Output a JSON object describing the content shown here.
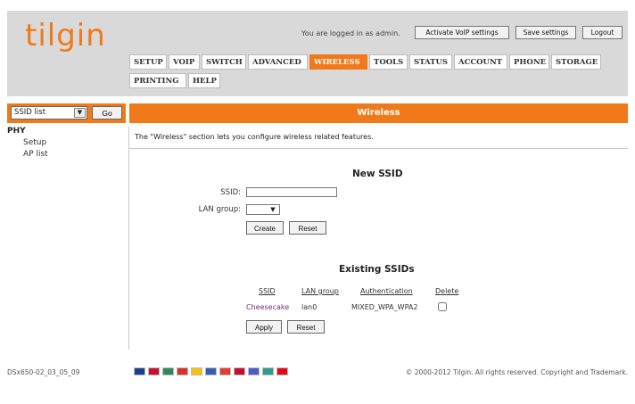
{
  "header": {
    "logo_text": "tilgin",
    "login_text": "You are logged in as admin.",
    "buttons": {
      "activate_voip": "Activate VoIP settings",
      "save_settings": "Save settings",
      "logout": "Logout"
    }
  },
  "nav": {
    "tabs": [
      "SETUP",
      "VOIP",
      "SWITCH",
      "ADVANCED",
      "WIRELESS",
      "TOOLS",
      "STATUS",
      "ACCOUNT",
      "PHONE",
      "STORAGE",
      "PRINTING",
      "HELP"
    ],
    "active_tab": "WIRELESS"
  },
  "left_panel": {
    "select_value": "SSID list",
    "go_label": "Go",
    "group_title": "PHY",
    "links": [
      "Setup",
      "AP list"
    ]
  },
  "main": {
    "title": "Wireless",
    "description": "The \"Wireless\" section lets you configure wireless related features.",
    "new_ssid": {
      "heading": "New SSID",
      "ssid_label": "SSID:",
      "ssid_value": "",
      "lan_group_label": "LAN group:",
      "lan_group_value": "",
      "create_label": "Create",
      "reset_label": "Reset"
    },
    "existing": {
      "heading": "Existing SSIDs",
      "columns": [
        "SSID",
        "LAN group",
        "Authentication",
        "Delete"
      ],
      "rows": [
        {
          "ssid": "Cheesecake",
          "lan_group": "lan0",
          "authentication": "MIXED_WPA_WPA2",
          "delete": false
        }
      ],
      "apply_label": "Apply",
      "reset_label": "Reset"
    }
  },
  "footer": {
    "version": "DSx650-02_03_05_09",
    "copyright": "© 2000-2012 Tilgin. All rights reserved. Copyright and Trademark.",
    "flag_colors": [
      "#1a3f8f",
      "#c8102e",
      "#2e8b57",
      "#d9302c",
      "#f4c20d",
      "#3b5bb5",
      "#e03c31",
      "#c60c30",
      "#4b5dc2",
      "#2a9d8f",
      "#e30a17"
    ]
  }
}
